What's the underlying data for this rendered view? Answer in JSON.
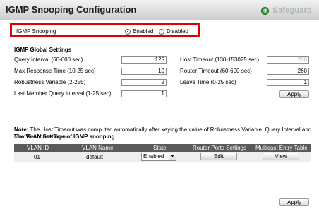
{
  "header": {
    "title": "IGMP Snooping Configuration",
    "brand": "Safeguard",
    "brand_icon": "safeguard-icon"
  },
  "snooping": {
    "label": "IGMP Snooping",
    "options": [
      "Enabled",
      "Disabled"
    ],
    "selected": "Enabled"
  },
  "global": {
    "title": "IGMP Global Settings",
    "left": [
      {
        "label": "Query Interval (60-600 sec)",
        "value": "125"
      },
      {
        "label": "Max Response Time (10-25 sec)",
        "value": "10"
      },
      {
        "label": "Robustness Variable (2-255)",
        "value": "2"
      },
      {
        "label": "Last Member Query Interval (1-25 sec)",
        "value": "1"
      }
    ],
    "right": [
      {
        "label": "Host Timeout (130-153025 sec)",
        "value": "260"
      },
      {
        "label": "Router Timeout (60-600 sec)",
        "value": "260"
      },
      {
        "label": "Leave Time (0-25 sec)",
        "value": "1"
      }
    ],
    "apply_label": "Apply"
  },
  "note": {
    "prefix": "Note:",
    "text": " The Host Timeout was computed automatically after keying the value of Robustness Variable, Query Interval and Max Response Time."
  },
  "vlan": {
    "title": "The VLAN Settings of IGMP snooping",
    "columns": [
      "VLAN ID",
      "VLAN Name",
      "State",
      "Router Ports Settings",
      "Multicast Entry Table"
    ],
    "rows": [
      {
        "vlan_id": "01",
        "vlan_name": "default",
        "state": "Enabled",
        "router_ports_btn": "Edit",
        "multicast_btn": "View"
      }
    ]
  },
  "footer": {
    "apply_label": "Apply"
  }
}
